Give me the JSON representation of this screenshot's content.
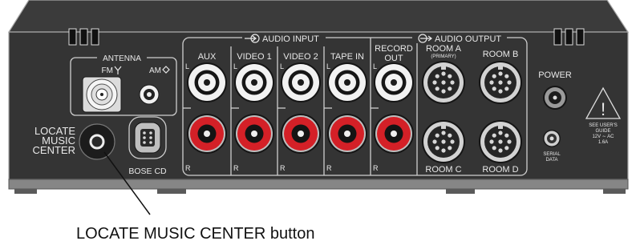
{
  "panel": {
    "antenna": {
      "title": "ANTENNA",
      "fm_label": "FM",
      "am_label": "AM"
    },
    "locate": {
      "lines": [
        "LOCATE",
        "MUSIC",
        "CENTER"
      ]
    },
    "bose_cd": {
      "label": "BOSE CD"
    },
    "audio_input": {
      "title": "AUDIO INPUT",
      "channel_left": "L",
      "channel_right": "R",
      "jacks": [
        {
          "label": "AUX"
        },
        {
          "label": "VIDEO 1"
        },
        {
          "label": "VIDEO 2"
        },
        {
          "label": "TAPE IN"
        }
      ]
    },
    "audio_output": {
      "title": "AUDIO OUTPUT",
      "record_out": [
        "RECORD",
        "OUT"
      ],
      "rooms": [
        {
          "label": "ROOM A",
          "note": "(PRIMARY)"
        },
        {
          "label": "ROOM B"
        },
        {
          "label": "ROOM C"
        },
        {
          "label": "ROOM D"
        }
      ]
    },
    "power": {
      "label": "POWER"
    },
    "serial": {
      "lines": [
        "SERIAL",
        "DATA"
      ]
    },
    "warning": {
      "symbol": "!",
      "lines": [
        "SEE USER'S",
        "GUIDE",
        "12V ∼ AC",
        "1.6A"
      ]
    }
  },
  "callout": {
    "label": "LOCATE MUSIC CENTER button"
  },
  "icons": {
    "fm": "fm-antenna-icon",
    "am": "am-antenna-icon",
    "audio_input": "input-arrow-icon",
    "audio_output": "output-arrow-icon",
    "warning": "warning-triangle-icon",
    "vents": "vent-slot-icon"
  },
  "colors": {
    "panel_face": "#343434",
    "panel_top": "#3b3b3b",
    "line": "#cfcfcf",
    "label": "#e8e8e8",
    "rca_red": "#d42027",
    "rca_white": "#f2f2f2",
    "base": "#868686",
    "callout": "#111111"
  }
}
